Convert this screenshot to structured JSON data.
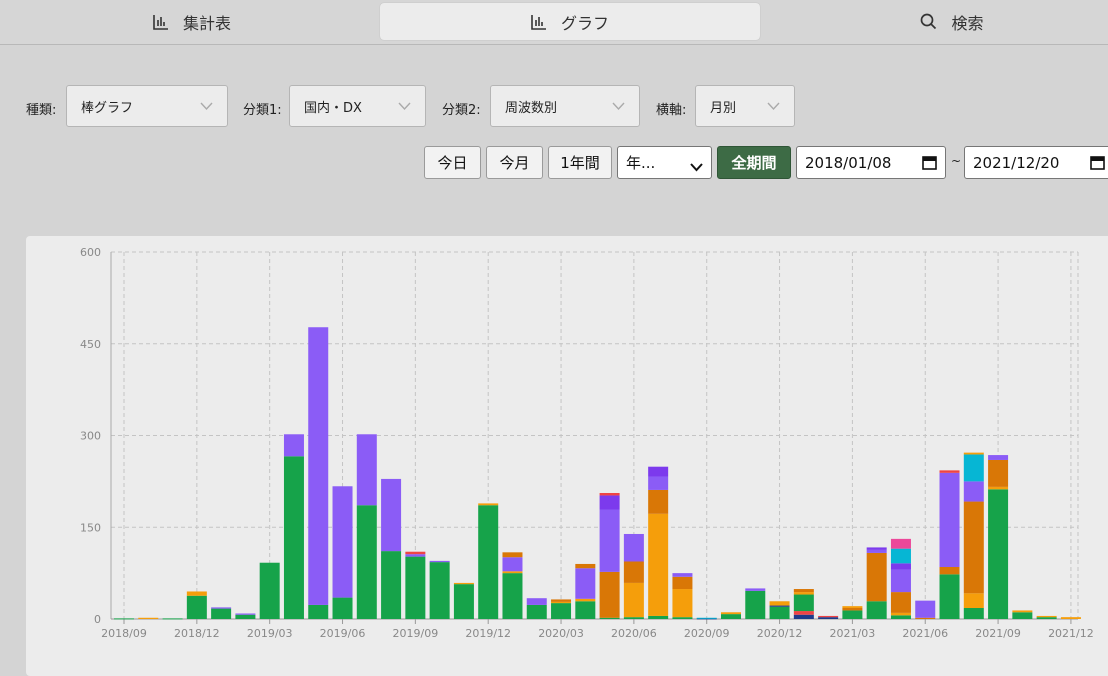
{
  "tabs": [
    {
      "label": "集計表",
      "icon": "bar-chart-icon"
    },
    {
      "label": "グラフ",
      "icon": "bar-chart-icon"
    },
    {
      "label": "検索",
      "icon": "search-icon"
    }
  ],
  "filters": {
    "kind": {
      "label": "種類:",
      "value": "棒グラフ"
    },
    "cat1": {
      "label": "分類1:",
      "value": "国内・DX"
    },
    "cat2": {
      "label": "分類2:",
      "value": "周波数別"
    },
    "xaxis": {
      "label": "横軸:",
      "value": "月別"
    }
  },
  "range": {
    "today": "今日",
    "this_month": "今月",
    "one_year": "1年間",
    "year_select": "年...",
    "all": "全期間",
    "start": "2018/01/08",
    "sep": "~",
    "end": "2021/12/20"
  },
  "colors": {
    "green": "#16a34a",
    "purple": "#8b5cf6",
    "orange": "#f59e0b",
    "dark_orange": "#d97706",
    "cyan": "#06b6d4",
    "pink": "#ec4899",
    "red": "#ef4444",
    "violet": "#7c3aed",
    "navy": "#1e3a8a",
    "accent": "#3d6b45"
  },
  "chart_data": {
    "type": "bar",
    "stacked": true,
    "ylim": [
      0,
      600
    ],
    "yticks": [
      0,
      150,
      300,
      450,
      600
    ],
    "xtick_labels": [
      "2018/09",
      "2018/12",
      "2019/03",
      "2019/06",
      "2019/09",
      "2019/12",
      "2020/03",
      "2020/06",
      "2020/09",
      "2020/12",
      "2021/03",
      "2021/06",
      "2021/09",
      "2021/12"
    ],
    "grid": true,
    "legend": "none",
    "categories": [
      "2018/09",
      "2018/10",
      "2018/11",
      "2018/12",
      "2019/01",
      "2019/02",
      "2019/03",
      "2019/04",
      "2019/05",
      "2019/06",
      "2019/07",
      "2019/08",
      "2019/09",
      "2019/10",
      "2019/11",
      "2019/12",
      "2020/01",
      "2020/02",
      "2020/03",
      "2020/04",
      "2020/05",
      "2020/06",
      "2020/07",
      "2020/08",
      "2020/09",
      "2020/10",
      "2020/11",
      "2020/12",
      "2021/01",
      "2021/02",
      "2021/03",
      "2021/04",
      "2021/05",
      "2021/06",
      "2021/07",
      "2021/08",
      "2021/09",
      "2021/10",
      "2021/11",
      "2021/12"
    ],
    "stacks": [
      [
        {
          "c": "green",
          "v": 1
        }
      ],
      [
        {
          "c": "orange",
          "v": 2
        }
      ],
      [
        {
          "c": "green",
          "v": 1
        }
      ],
      [
        {
          "c": "green",
          "v": 38
        },
        {
          "c": "orange",
          "v": 7
        }
      ],
      [
        {
          "c": "green",
          "v": 17
        },
        {
          "c": "purple",
          "v": 2
        }
      ],
      [
        {
          "c": "green",
          "v": 7
        },
        {
          "c": "purple",
          "v": 2
        }
      ],
      [
        {
          "c": "green",
          "v": 92
        }
      ],
      [
        {
          "c": "green",
          "v": 266
        },
        {
          "c": "purple",
          "v": 36
        }
      ],
      [
        {
          "c": "green",
          "v": 23
        },
        {
          "c": "purple",
          "v": 454
        }
      ],
      [
        {
          "c": "green",
          "v": 35
        },
        {
          "c": "purple",
          "v": 182
        }
      ],
      [
        {
          "c": "green",
          "v": 186
        },
        {
          "c": "purple",
          "v": 116
        }
      ],
      [
        {
          "c": "green",
          "v": 111
        },
        {
          "c": "purple",
          "v": 118
        }
      ],
      [
        {
          "c": "green",
          "v": 102
        },
        {
          "c": "purple",
          "v": 4
        },
        {
          "c": "red",
          "v": 4
        }
      ],
      [
        {
          "c": "green",
          "v": 93
        },
        {
          "c": "purple",
          "v": 2
        }
      ],
      [
        {
          "c": "green",
          "v": 57
        },
        {
          "c": "orange",
          "v": 2
        }
      ],
      [
        {
          "c": "green",
          "v": 186
        },
        {
          "c": "orange",
          "v": 3
        }
      ],
      [
        {
          "c": "green",
          "v": 75
        },
        {
          "c": "orange",
          "v": 3
        },
        {
          "c": "purple",
          "v": 23
        },
        {
          "c": "dark_orange",
          "v": 8
        }
      ],
      [
        {
          "c": "green",
          "v": 23
        },
        {
          "c": "purple",
          "v": 11
        }
      ],
      [
        {
          "c": "green",
          "v": 26
        },
        {
          "c": "orange",
          "v": 2
        },
        {
          "c": "dark_orange",
          "v": 4
        }
      ],
      [
        {
          "c": "green",
          "v": 29
        },
        {
          "c": "orange",
          "v": 4
        },
        {
          "c": "purple",
          "v": 50
        },
        {
          "c": "dark_orange",
          "v": 7
        }
      ],
      [
        {
          "c": "green",
          "v": 2
        },
        {
          "c": "dark_orange",
          "v": 75
        },
        {
          "c": "purple",
          "v": 102
        },
        {
          "c": "violet",
          "v": 23
        },
        {
          "c": "red",
          "v": 4
        }
      ],
      [
        {
          "c": "green",
          "v": 3
        },
        {
          "c": "orange",
          "v": 56
        },
        {
          "c": "dark_orange",
          "v": 35
        },
        {
          "c": "purple",
          "v": 45
        }
      ],
      [
        {
          "c": "green",
          "v": 5
        },
        {
          "c": "orange",
          "v": 167
        },
        {
          "c": "dark_orange",
          "v": 39
        },
        {
          "c": "purple",
          "v": 22
        },
        {
          "c": "violet",
          "v": 16
        }
      ],
      [
        {
          "c": "green",
          "v": 3
        },
        {
          "c": "orange",
          "v": 46
        },
        {
          "c": "dark_orange",
          "v": 20
        },
        {
          "c": "purple",
          "v": 6
        }
      ],
      [
        {
          "c": "navy",
          "v": 1
        },
        {
          "c": "cyan",
          "v": 1
        }
      ],
      [
        {
          "c": "green",
          "v": 8
        },
        {
          "c": "orange",
          "v": 3
        }
      ],
      [
        {
          "c": "green",
          "v": 46
        },
        {
          "c": "purple",
          "v": 4
        }
      ],
      [
        {
          "c": "green",
          "v": 20
        },
        {
          "c": "navy",
          "v": 2
        },
        {
          "c": "orange",
          "v": 7
        }
      ],
      [
        {
          "c": "navy",
          "v": 7
        },
        {
          "c": "red",
          "v": 6
        },
        {
          "c": "green",
          "v": 27
        },
        {
          "c": "orange",
          "v": 4
        },
        {
          "c": "dark_orange",
          "v": 5
        }
      ],
      [
        {
          "c": "navy",
          "v": 3
        },
        {
          "c": "red",
          "v": 2
        }
      ],
      [
        {
          "c": "green",
          "v": 14
        },
        {
          "c": "dark_orange",
          "v": 4
        },
        {
          "c": "orange",
          "v": 3
        }
      ],
      [
        {
          "c": "green",
          "v": 29
        },
        {
          "c": "dark_orange",
          "v": 79
        },
        {
          "c": "purple",
          "v": 5
        },
        {
          "c": "violet",
          "v": 4
        }
      ],
      [
        {
          "c": "green",
          "v": 6
        },
        {
          "c": "orange",
          "v": 4
        },
        {
          "c": "dark_orange",
          "v": 34
        },
        {
          "c": "purple",
          "v": 37
        },
        {
          "c": "violet",
          "v": 10
        },
        {
          "c": "cyan",
          "v": 24
        },
        {
          "c": "pink",
          "v": 16
        }
      ],
      [
        {
          "c": "dark_orange",
          "v": 2
        },
        {
          "c": "purple",
          "v": 28
        }
      ],
      [
        {
          "c": "green",
          "v": 73
        },
        {
          "c": "dark_orange",
          "v": 12
        },
        {
          "c": "purple",
          "v": 154
        },
        {
          "c": "red",
          "v": 4
        }
      ],
      [
        {
          "c": "green",
          "v": 18
        },
        {
          "c": "orange",
          "v": 24
        },
        {
          "c": "dark_orange",
          "v": 150
        },
        {
          "c": "purple",
          "v": 33
        },
        {
          "c": "cyan",
          "v": 44
        },
        {
          "c": "orange",
          "v": 3
        }
      ],
      [
        {
          "c": "green",
          "v": 212
        },
        {
          "c": "orange",
          "v": 4
        },
        {
          "c": "dark_orange",
          "v": 44
        },
        {
          "c": "purple",
          "v": 8
        }
      ],
      [
        {
          "c": "green",
          "v": 11
        },
        {
          "c": "orange",
          "v": 3
        }
      ],
      [
        {
          "c": "green",
          "v": 3
        },
        {
          "c": "orange",
          "v": 2
        }
      ],
      [
        {
          "c": "orange",
          "v": 3
        }
      ]
    ]
  }
}
